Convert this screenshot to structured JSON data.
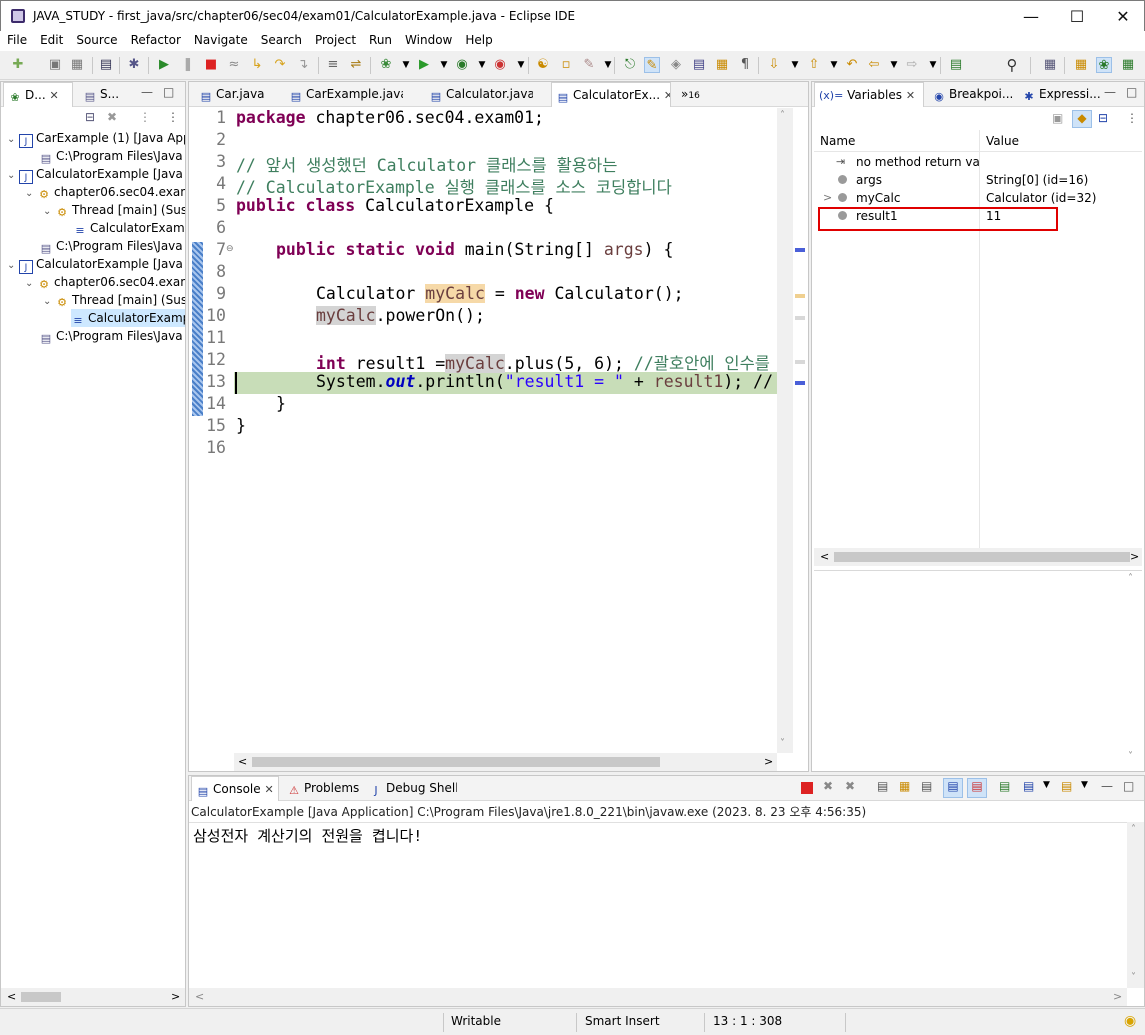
{
  "window": {
    "title": "JAVA_STUDY - first_java/src/chapter06/sec04/exam01/CalculatorExample.java - Eclipse IDE"
  },
  "menu": [
    "File",
    "Edit",
    "Source",
    "Refactor",
    "Navigate",
    "Search",
    "Project",
    "Run",
    "Window",
    "Help"
  ],
  "left_panel": {
    "tabs": [
      {
        "label": "D..."
      },
      {
        "label": "S..."
      }
    ],
    "tree": [
      {
        "label": "CarExample (1) [Java App",
        "icon": "java-app-icon",
        "twisty": "⌄"
      },
      {
        "label": "C:\\Program Files\\Java",
        "icon": "process-icon",
        "twisty": ""
      },
      {
        "label": "CalculatorExample [Java A",
        "icon": "java-app-icon",
        "twisty": "⌄"
      },
      {
        "label": "chapter06.sec04.exam",
        "icon": "thread-group-icon",
        "twisty": "⌄"
      },
      {
        "label": "Thread [main] (Susp",
        "icon": "thread-icon",
        "twisty": "⌄"
      },
      {
        "label": "CalculatorExamp",
        "icon": "stack-frame-icon",
        "twisty": ""
      },
      {
        "label": "C:\\Program Files\\Java",
        "icon": "process-icon",
        "twisty": ""
      },
      {
        "label": "CalculatorExample [Java A",
        "icon": "java-app-icon",
        "twisty": "⌄"
      },
      {
        "label": "chapter06.sec04.exam",
        "icon": "thread-group-icon",
        "twisty": "⌄"
      },
      {
        "label": "Thread [main] (Susp",
        "icon": "thread-icon",
        "twisty": "⌄"
      },
      {
        "label": "CalculatorExamp",
        "icon": "stack-frame-icon",
        "twisty": ""
      },
      {
        "label": "C:\\Program Files\\Java",
        "icon": "process-icon",
        "twisty": ""
      }
    ]
  },
  "editor": {
    "tabs": [
      {
        "label": "Car.java"
      },
      {
        "label": "CarExample.java"
      },
      {
        "label": "Calculator.java"
      },
      {
        "label": "CalculatorEx..."
      }
    ],
    "overflow_count": "16",
    "line_numbers": [
      "1",
      "2",
      "3",
      "4",
      "5",
      "6",
      "7",
      "8",
      "9",
      "10",
      "11",
      "12",
      "13",
      "14",
      "15",
      "16"
    ],
    "lines": {
      "l1_kw": "package",
      "l1": " chapter06.sec04.exam01;",
      "l3": "// 앞서 생성했던 Calculator 클래스를 활용하는",
      "l4": "// CalculatorExample 실행 클래스를 소스 코딩합니다",
      "l5_kw": "public class",
      "l5": " CalculatorExample {",
      "l7_kw": "public static void",
      "l7_a": " main(String[] ",
      "l7_var": "args",
      "l7_b": ") {",
      "l9_a": "Calculator ",
      "l9_var": "myCalc",
      "l9_b": " = ",
      "l9_kw": "new",
      "l9_c": " Calculator();",
      "l10_var": "myCalc",
      "l10_a": ".powerOn();",
      "l12_kw": "int",
      "l12_a": " result1 =",
      "l12_var": "myCalc",
      "l12_b": ".plus(5, 6); ",
      "l12_cm": "//괄호안에 인수를 보",
      "l13_a": "System.",
      "l13_fld": "out",
      "l13_b": ".println(",
      "l13_st": "\"result1 = \"",
      "l13_c": " + ",
      "l13_var": "result1",
      "l13_d": "); //",
      "l14": "}",
      "l15": "}"
    }
  },
  "variables": {
    "tabs": [
      {
        "label": "Variables"
      },
      {
        "label": "Breakpoi..."
      },
      {
        "label": "Expressi..."
      }
    ],
    "tab_prefix": "(x)=",
    "col_name": "Name",
    "col_value": "Value",
    "rows": [
      {
        "name": "no method return value",
        "value": "",
        "icon": "return-value-icon",
        "twisty": ""
      },
      {
        "name": "args",
        "value": "String[0]  (id=16)",
        "icon": "local-var-icon",
        "twisty": ""
      },
      {
        "name": "myCalc",
        "value": "Calculator  (id=32)",
        "icon": "local-var-icon",
        "twisty": ">"
      },
      {
        "name": "result1",
        "value": "11",
        "icon": "local-var-icon",
        "twisty": ""
      }
    ],
    "highlight_color": "#e00000"
  },
  "console": {
    "tabs": [
      {
        "label": "Console"
      },
      {
        "label": "Problems"
      },
      {
        "label": "Debug Shell"
      }
    ],
    "launch": "CalculatorExample [Java Application] C:\\Program Files\\Java\\jre1.8.0_221\\bin\\javaw.exe  (2023. 8. 23 오후 4:56:35)",
    "output": "삼성전자 계산기의 전원을 켭니다!"
  },
  "status": {
    "writable": "Writable",
    "insert": "Smart Insert",
    "position": "13 : 1 : 308"
  },
  "colors": {
    "keyword": "#7f0055",
    "comment": "#3f7f5f",
    "string": "#2a00ff",
    "current_line": "#c8ddb8"
  }
}
